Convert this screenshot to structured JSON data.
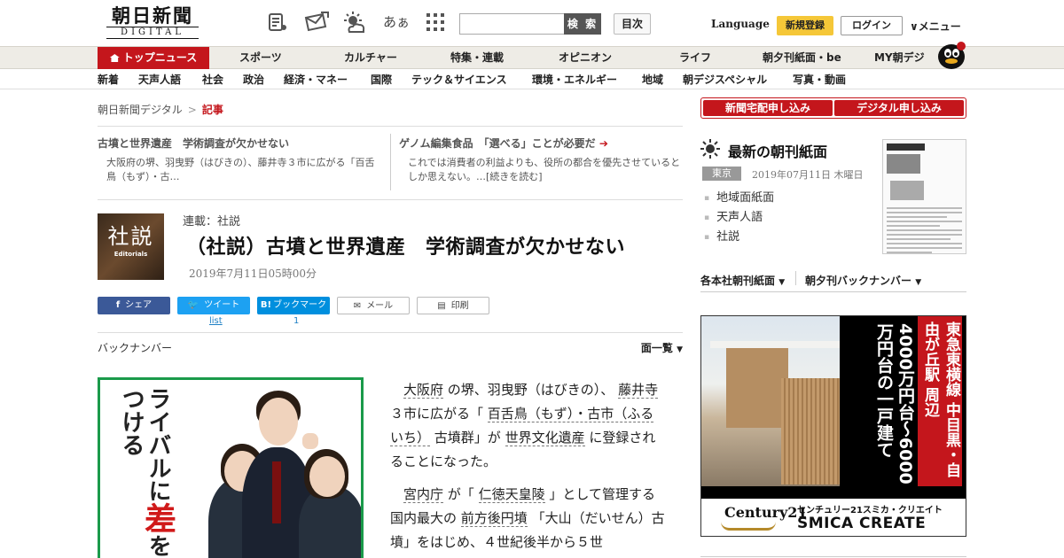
{
  "header": {
    "logo_main": "朝日新聞",
    "logo_sub": "DIGITAL",
    "search_button": "検 索",
    "index_button": "目次",
    "language": "Language",
    "signup": "新規登録",
    "login": "ログイン",
    "menu": "メニュー",
    "font_size_icon_text": "あぁ"
  },
  "nav_primary": [
    "トップニュース",
    "スポーツ",
    "カルチャー",
    "特集・連載",
    "オピニオン",
    "ライフ",
    "朝夕刊紙面・be",
    "MY朝デジ"
  ],
  "nav_secondary": [
    "新着",
    "天声人語",
    "社会",
    "政治",
    "経済・マネー",
    "国際",
    "テック＆サイエンス",
    "環境・エネルギー",
    "地域",
    "朝デジスペシャル",
    "写真・動画"
  ],
  "breadcrumb": {
    "home": "朝日新聞デジタル",
    "separator": ">",
    "current": "記事"
  },
  "related": [
    {
      "title": "古墳と世界遺産　学術調査が欠かせない",
      "text": "大阪府の堺、羽曳野（はびきの）、藤井寺３市に広がる「百舌鳥（もず）・古…"
    },
    {
      "title": "ゲノム編集食品　「選べる」ことが必要だ",
      "text": "これでは消費者の利益よりも、役所の都合を優先させているとしか思えない。…[続きを読む]"
    }
  ],
  "article": {
    "thumb_main": "社説",
    "thumb_sub": "Editorials",
    "series": "連載：社説",
    "headline": "（社説）古墳と世界遺産　学術調査が欠かせない",
    "date": "2019年7月11日05時00分",
    "body": [
      [
        "大阪府",
        "の堺、羽曳野（はびきの）、",
        "藤井寺",
        "３市に広がる「",
        "百舌鳥（もず）・古市（ふるいち）",
        "古墳群」が",
        "世界文化遺産",
        "に登録されることになった。"
      ],
      [
        "宮内庁",
        "が「",
        "仁徳天皇陵",
        "」として管理する国内最大の",
        "前方後円墳",
        "「大山（だいせん）古墳」をはじめ、４世紀後半から５世"
      ]
    ]
  },
  "share": {
    "facebook": "シェア",
    "twitter": "ツイート",
    "hatena": "ブックマーク",
    "hatena_icon": "B!",
    "mail": "メール",
    "print": "印刷",
    "twitter_count": "list",
    "hatena_count": "1"
  },
  "backnumber": {
    "label": "バックナンバー",
    "list": "面一覧"
  },
  "ad_left": {
    "text_top": "差",
    "text_rest": "をつける",
    "text_col2": "ライバルに"
  },
  "sidebar": {
    "subscribe_paper": "新聞宅配申し込み",
    "subscribe_digital": "デジタル申し込み",
    "latest_title": "最新の朝刊紙面",
    "region": "東京",
    "edition_date": "2019年07月11日 木曜日",
    "links": [
      "地域面紙面",
      "天声人語",
      "社説"
    ],
    "tab_regional": "各本社朝刊紙面",
    "tab_backnumber": "朝夕刊バックナンバー"
  },
  "ad_right": {
    "red_text": "東急東横線 中目黒・自由が丘駅 周辺",
    "white_text": "4000万円台〜6000万円台の一戸建て",
    "brand_logo": "Century21",
    "brand_name": "センチュリー21スミカ・クリエイト",
    "brand_en": "SMICA CREATE"
  }
}
